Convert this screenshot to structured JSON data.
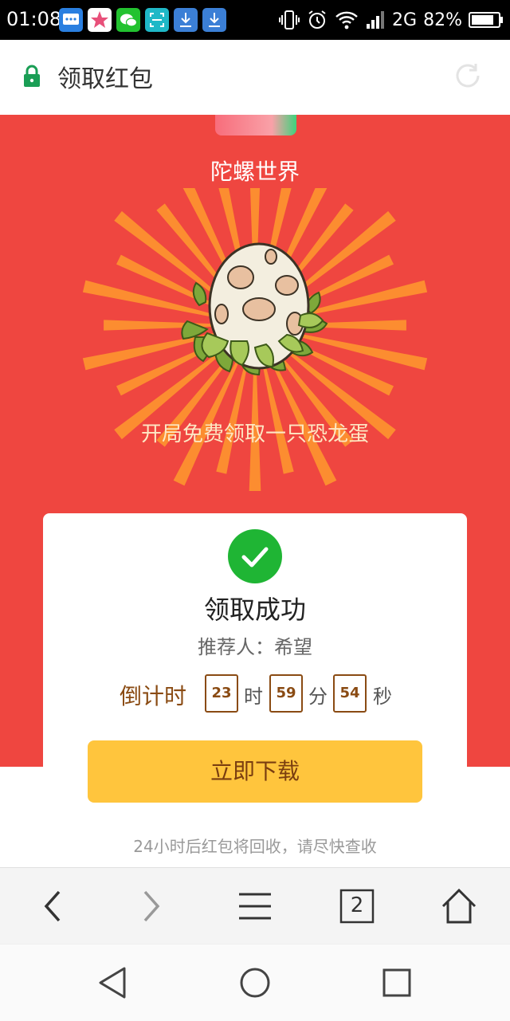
{
  "status_bar": {
    "time": "01:08",
    "network": "2G",
    "battery": "82%"
  },
  "browser": {
    "page_title": "领取红包",
    "tab_count": "2"
  },
  "hero": {
    "app_name": "陀螺世界",
    "tagline": "开局免费领取一只恐龙蛋"
  },
  "card": {
    "success_text": "领取成功",
    "referrer": "推荐人：希望",
    "countdown_label": "倒计时",
    "hours": "23",
    "hours_unit": "时",
    "minutes": "59",
    "minutes_unit": "分",
    "seconds": "54",
    "seconds_unit": "秒",
    "download_label": "立即下载",
    "notice": "24小时后红包将回收，请尽快查收"
  },
  "colors": {
    "hero_red": "#ef4640",
    "check_green": "#1fb534",
    "button_yellow": "#ffc53d",
    "countdown_brown": "#8a4b13"
  },
  "icons": {
    "lock": "lock-icon",
    "reload": "reload-icon",
    "back": "back-icon",
    "forward": "forward-icon",
    "menu": "menu-icon",
    "tabs": "tabs-icon",
    "home": "home-icon",
    "nav_back": "nav-back-icon",
    "nav_home": "nav-home-icon",
    "nav_recents": "nav-recents-icon"
  }
}
